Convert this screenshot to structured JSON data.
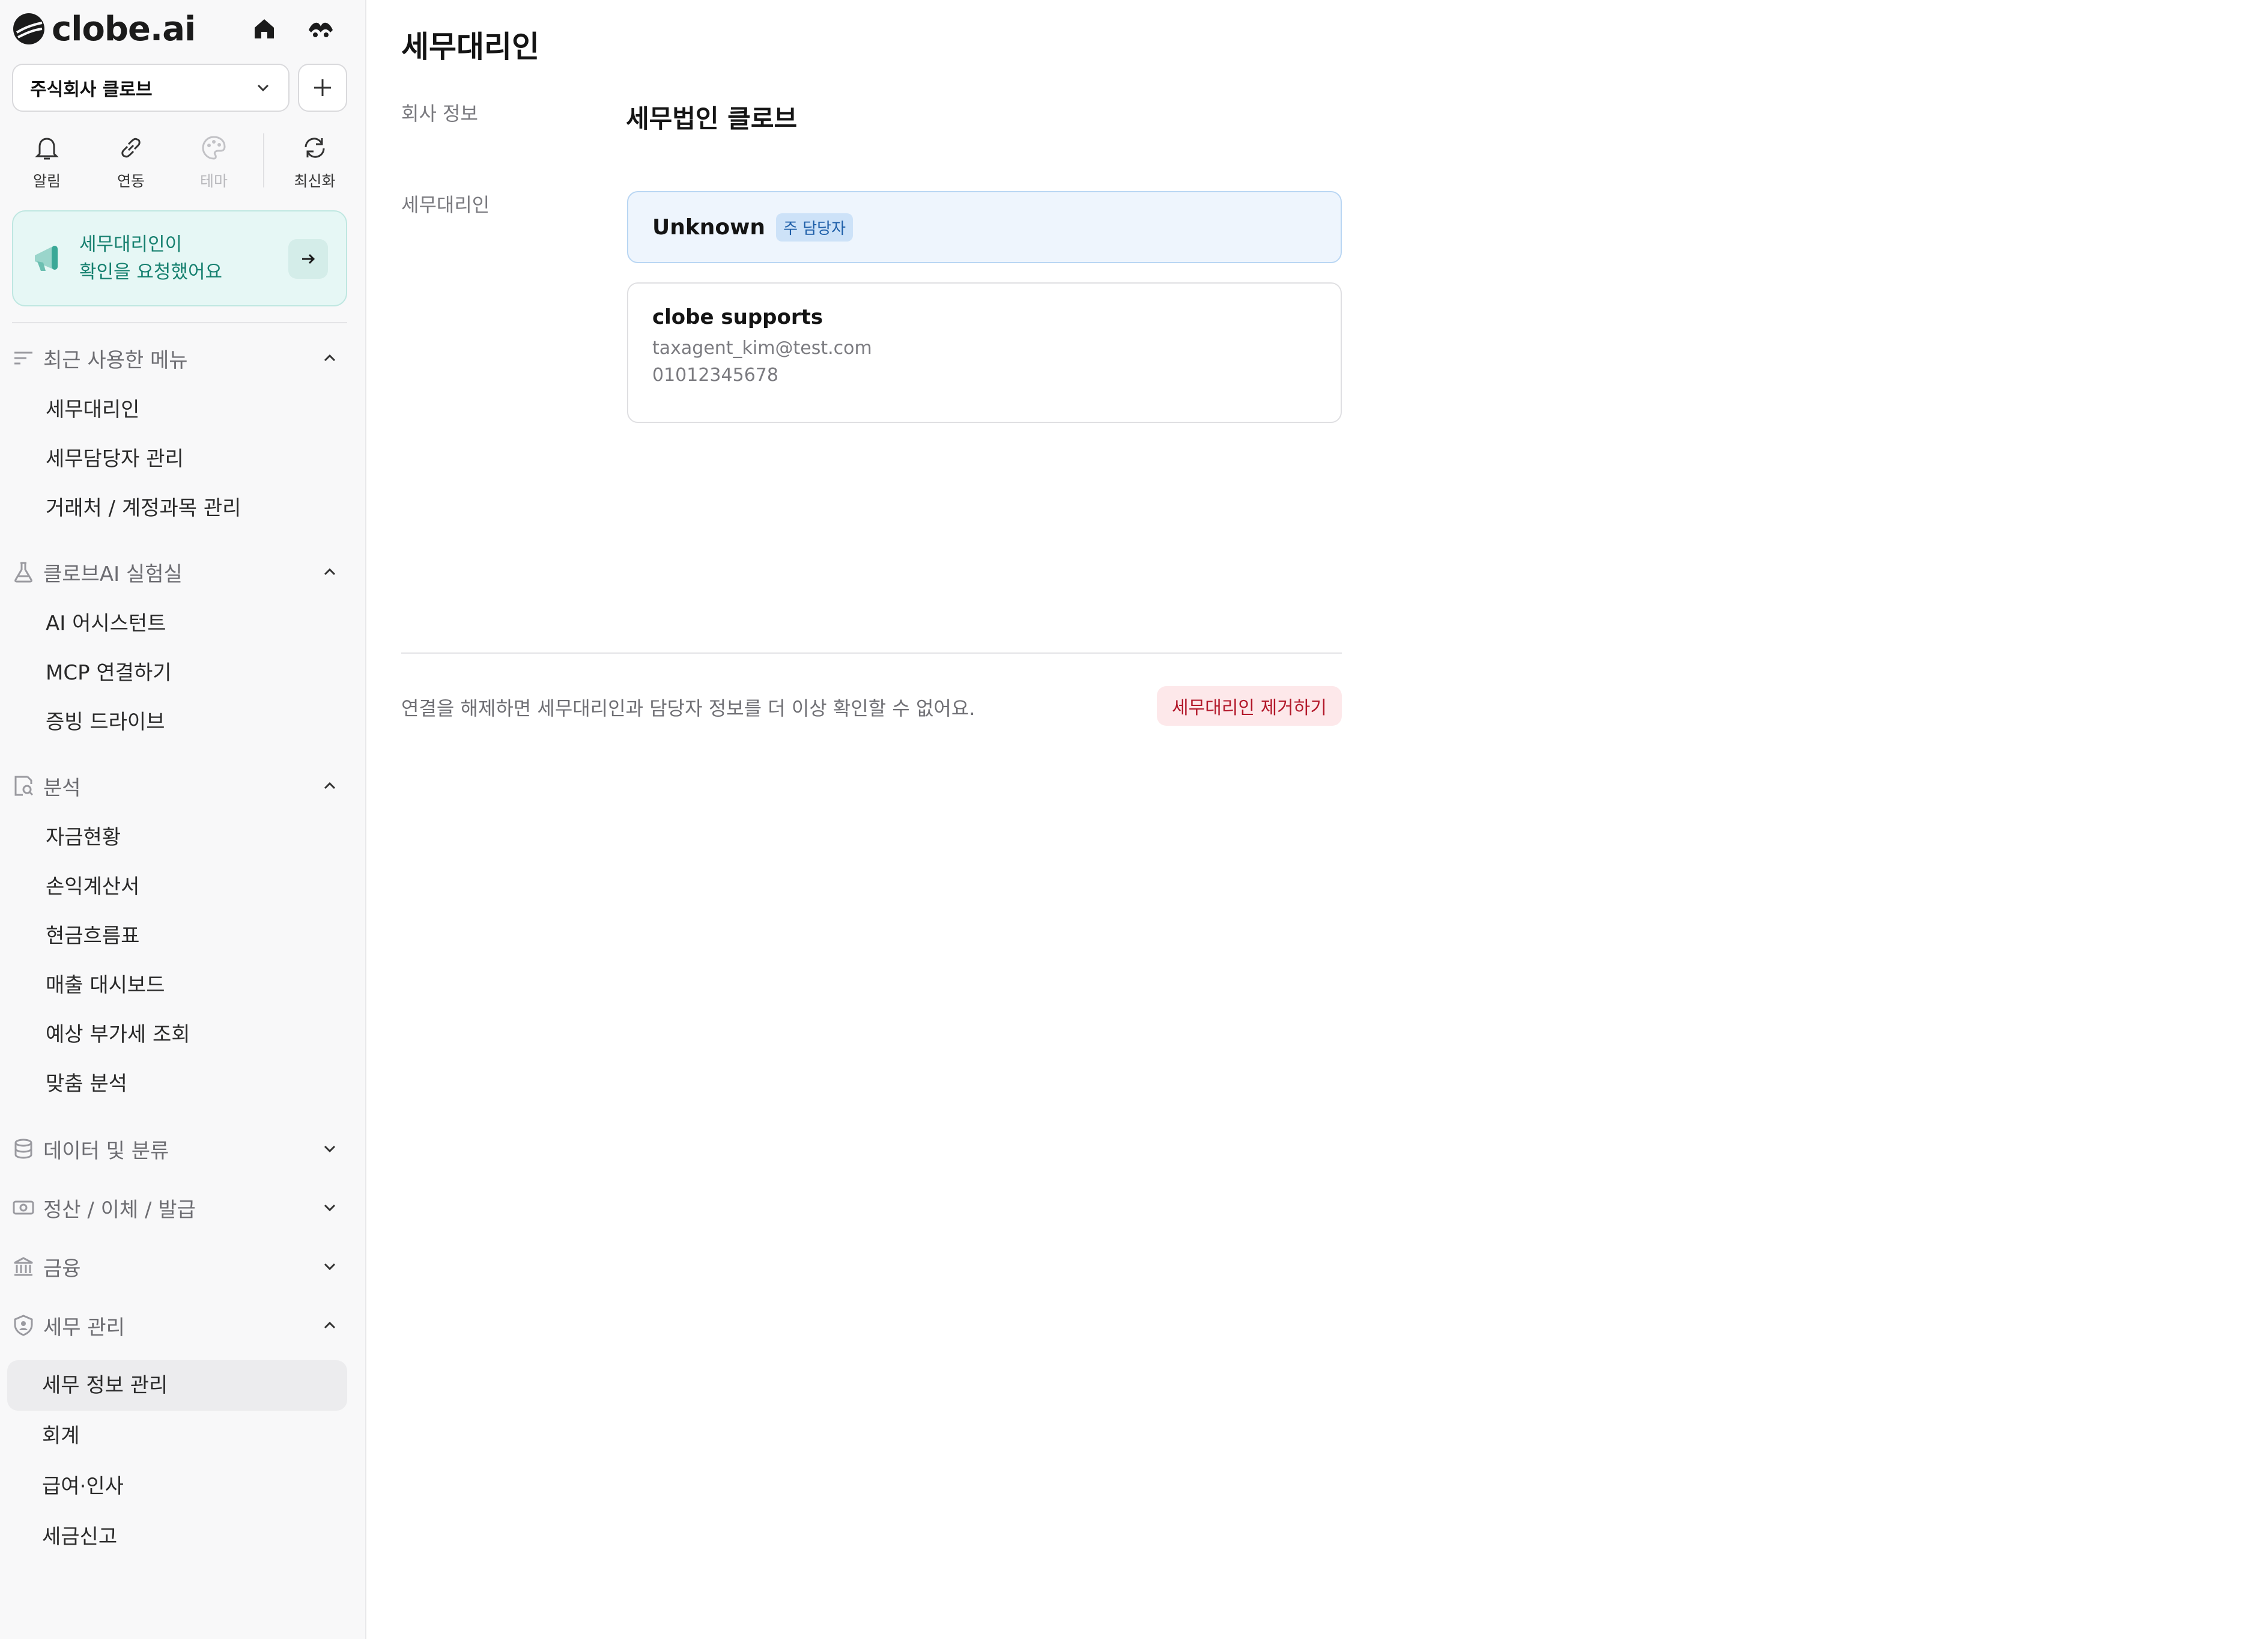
{
  "app": {
    "logo_text": "clobe.ai"
  },
  "sidebar": {
    "company_select": "주식회사 클로브",
    "quick_actions": [
      {
        "label": "알림",
        "icon": "bell-icon"
      },
      {
        "label": "연동",
        "icon": "link-icon"
      },
      {
        "label": "테마",
        "icon": "palette-icon",
        "disabled": true
      },
      {
        "label": "최신화",
        "icon": "refresh-icon"
      }
    ],
    "banner": {
      "line1": "세무대리인이",
      "line2": "확인을 요청했어요"
    },
    "sections": {
      "recent": {
        "title": "최근 사용한 메뉴",
        "items": [
          "세무대리인",
          "세무담당자 관리",
          "거래처 / 계정과목 관리"
        ]
      },
      "lab": {
        "title": "클로브AI 실험실",
        "items": [
          "AI 어시스턴트",
          "MCP 연결하기",
          "증빙 드라이브"
        ]
      },
      "analysis": {
        "title": "분석",
        "items": [
          "자금현황",
          "손익계산서",
          "현금흐름표",
          "매출 대시보드",
          "예상 부가세 조회",
          "맞춤 분석"
        ]
      },
      "data": {
        "title": "데이터 및 분류"
      },
      "settlement": {
        "title": "정산 / 이체 / 발급"
      },
      "finance": {
        "title": "금융"
      },
      "tax": {
        "title": "세무 관리",
        "items": [
          "세무 정보 관리",
          "회계",
          "급여·인사",
          "세금신고"
        ]
      }
    }
  },
  "main": {
    "title": "세무대리인",
    "company_label": "회사 정보",
    "company_name": "세무법인 클로브",
    "agent_label": "세무대리인",
    "primary": {
      "name": "Unknown",
      "badge": "주 담당자"
    },
    "agent": {
      "name": "clobe supports",
      "email": "taxagent_kim@test.com",
      "phone": "01012345678"
    },
    "footer_note": "연결을 해제하면 세무대리인과 담당자 정보를 더 이상 확인할 수 없어요.",
    "remove_button": "세무대리인 제거하기"
  },
  "colors": {
    "accent_teal": "#16806f",
    "danger": "#b3192b",
    "primary_card": "#eef5fd"
  }
}
